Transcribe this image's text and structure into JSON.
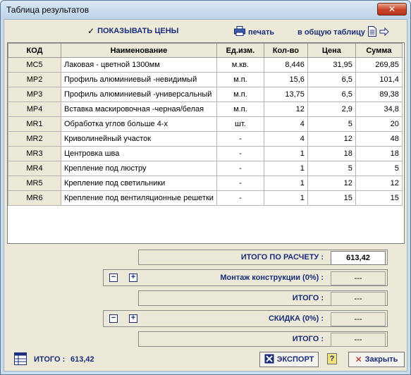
{
  "window": {
    "title": "Таблица результатов",
    "close_label": "✕"
  },
  "toolbar": {
    "show_prices_label": "ПОКАЗЫВАТЬ ЦЕНЫ",
    "show_prices_checked": true,
    "print_label": "печать",
    "to_table_label": "в общую таблицу"
  },
  "table": {
    "headers": [
      "КОД",
      "Наименование",
      "Ед.изм.",
      "Кол-во",
      "Цена",
      "Сумма"
    ],
    "rows": [
      {
        "code": "MC5",
        "name": "Лаковая - цветной 1300мм",
        "unit": "м.кв.",
        "qty": "8,446",
        "price": "31,95",
        "sum": "269,85"
      },
      {
        "code": "MP2",
        "name": "Профиль алюминиевый -невидимый",
        "unit": "м.п.",
        "qty": "15,6",
        "price": "6,5",
        "sum": "101,4"
      },
      {
        "code": "MP3",
        "name": "Профиль алюминиевый -универсальный",
        "unit": "м.п.",
        "qty": "13,75",
        "price": "6,5",
        "sum": "89,38"
      },
      {
        "code": "MP4",
        "name": "Вставка маскировочная -черная/белая",
        "unit": "м.п.",
        "qty": "12",
        "price": "2,9",
        "sum": "34,8"
      },
      {
        "code": "MR1",
        "name": "Обработка углов больше 4-х",
        "unit": "шт.",
        "qty": "4",
        "price": "5",
        "sum": "20"
      },
      {
        "code": "MR2",
        "name": "Криволинейный участок",
        "unit": "-",
        "qty": "4",
        "price": "12",
        "sum": "48"
      },
      {
        "code": "MR3",
        "name": "Центровка шва",
        "unit": "-",
        "qty": "1",
        "price": "18",
        "sum": "18"
      },
      {
        "code": "MR4",
        "name": "Крепление под люстру",
        "unit": "-",
        "qty": "1",
        "price": "5",
        "sum": "5"
      },
      {
        "code": "MR5",
        "name": "Крепление под светильники",
        "unit": "-",
        "qty": "1",
        "price": "12",
        "sum": "12"
      },
      {
        "code": "MR6",
        "name": "Крепление под вентиляционные решетки",
        "unit": "-",
        "qty": "1",
        "price": "15",
        "sum": "15"
      }
    ]
  },
  "summary": {
    "calc_total_label": "ИТОГО ПО РАСЧЕТУ :",
    "calc_total_value": "613,42",
    "mount_label": "Монтаж конструкции (0%) :",
    "mount_value": "---",
    "mount_total_label": "ИТОГО :",
    "mount_total_value": "---",
    "discount_label": "СКИДКА (0%) :",
    "discount_value": "---",
    "discount_total_label": "ИТОГО :",
    "discount_total_value": "---"
  },
  "footer": {
    "total_label": "ИТОГО :",
    "total_value": "613,42",
    "export_label": "ЭКСПОРТ",
    "help_label": "?",
    "close_label": "Закрыть"
  },
  "colors": {
    "accent": "#1a2d7a",
    "grid_header": "#ece9d8",
    "window_frame": "#c9dceb"
  }
}
